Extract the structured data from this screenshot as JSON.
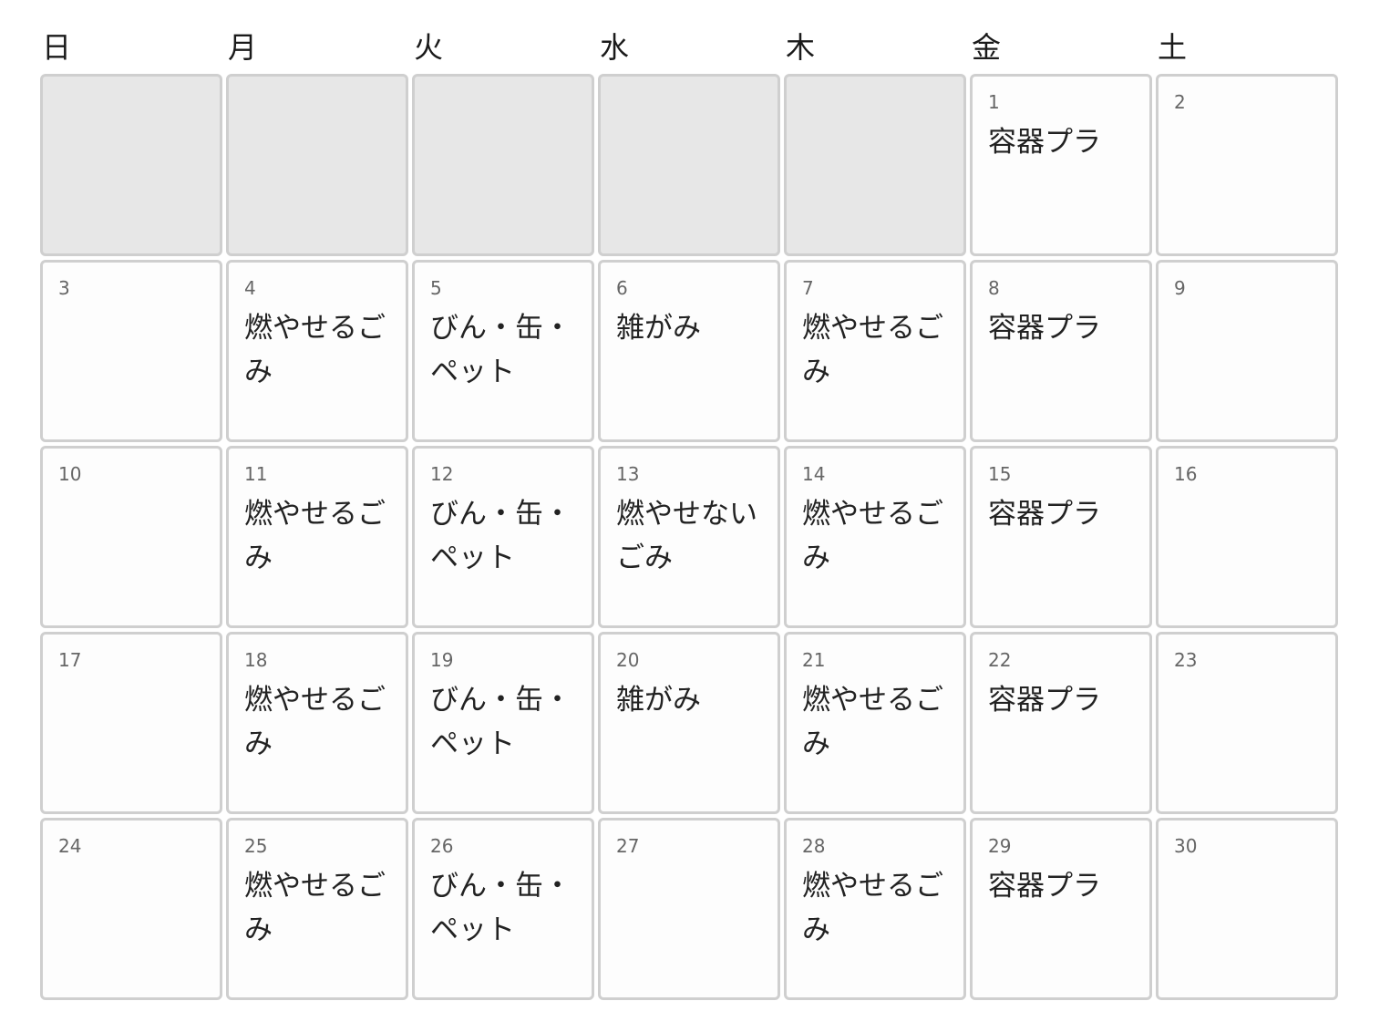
{
  "weekdays": [
    "日",
    "月",
    "火",
    "水",
    "木",
    "金",
    "土"
  ],
  "days": [
    {
      "day": "",
      "event": "",
      "empty": true
    },
    {
      "day": "",
      "event": "",
      "empty": true
    },
    {
      "day": "",
      "event": "",
      "empty": true
    },
    {
      "day": "",
      "event": "",
      "empty": true
    },
    {
      "day": "",
      "event": "",
      "empty": true
    },
    {
      "day": "1",
      "event": "容器プラ"
    },
    {
      "day": "2",
      "event": ""
    },
    {
      "day": "3",
      "event": ""
    },
    {
      "day": "4",
      "event": "燃やせるごみ"
    },
    {
      "day": "5",
      "event": "びん・缶・ペット"
    },
    {
      "day": "6",
      "event": "雑がみ"
    },
    {
      "day": "7",
      "event": "燃やせるごみ"
    },
    {
      "day": "8",
      "event": "容器プラ"
    },
    {
      "day": "9",
      "event": ""
    },
    {
      "day": "10",
      "event": ""
    },
    {
      "day": "11",
      "event": "燃やせるごみ"
    },
    {
      "day": "12",
      "event": "びん・缶・ペット"
    },
    {
      "day": "13",
      "event": "燃やせないごみ"
    },
    {
      "day": "14",
      "event": "燃やせるごみ"
    },
    {
      "day": "15",
      "event": "容器プラ"
    },
    {
      "day": "16",
      "event": ""
    },
    {
      "day": "17",
      "event": ""
    },
    {
      "day": "18",
      "event": "燃やせるごみ"
    },
    {
      "day": "19",
      "event": "びん・缶・ペット"
    },
    {
      "day": "20",
      "event": "雑がみ"
    },
    {
      "day": "21",
      "event": "燃やせるごみ"
    },
    {
      "day": "22",
      "event": "容器プラ"
    },
    {
      "day": "23",
      "event": ""
    },
    {
      "day": "24",
      "event": ""
    },
    {
      "day": "25",
      "event": "燃やせるごみ"
    },
    {
      "day": "26",
      "event": "びん・缶・ペット"
    },
    {
      "day": "27",
      "event": ""
    },
    {
      "day": "28",
      "event": "燃やせるごみ"
    },
    {
      "day": "29",
      "event": "容器プラ"
    },
    {
      "day": "30",
      "event": ""
    }
  ],
  "colors": {
    "empty_cell": "#e7e7e7",
    "cell_border": "#cfcfcf",
    "day_number": "#666666",
    "event_text": "#222222"
  }
}
